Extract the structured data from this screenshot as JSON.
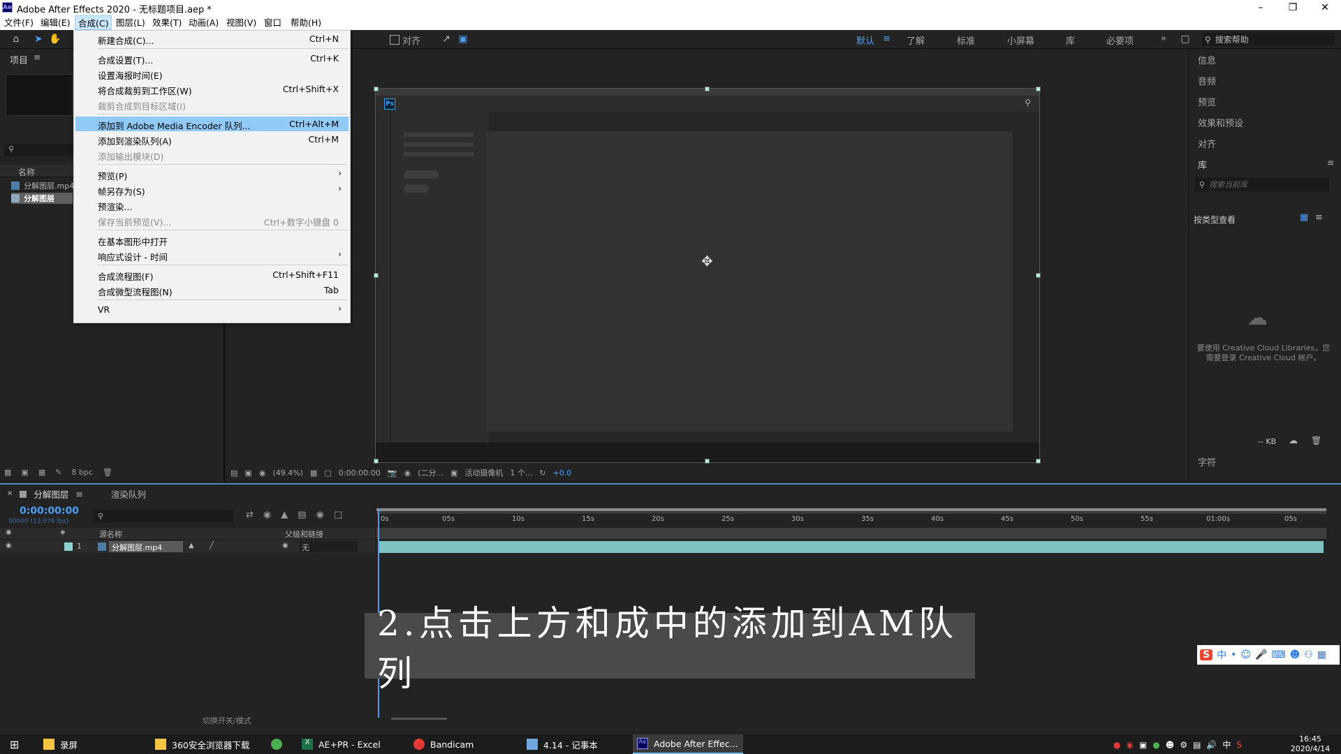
{
  "window": {
    "title": "Adobe After Effects 2020 - 无标题项目.aep *"
  },
  "menubar": [
    "文件(F)",
    "编辑(E)",
    "合成(C)",
    "图层(L)",
    "效果(T)",
    "动画(A)",
    "视图(V)",
    "窗口",
    "帮助(H)"
  ],
  "toolbar": {
    "align_label": "对齐",
    "workspaces": [
      "默认",
      "了解",
      "标准",
      "小屏幕",
      "库",
      "必要项"
    ],
    "search_help": "搜索帮助"
  },
  "project_panel": {
    "title": "项目",
    "col_name": "名称",
    "items": [
      "分解图层.mp4",
      "分解图层"
    ],
    "bpc": "8 bpc"
  },
  "composition_menu": {
    "items": [
      {
        "label": "新建合成(C)...",
        "shortcut": "Ctrl+N"
      },
      {
        "label": "合成设置(T)...",
        "shortcut": "Ctrl+K"
      },
      {
        "label": "设置海报时间(E)",
        "shortcut": ""
      },
      {
        "label": "将合成裁剪到工作区(W)",
        "shortcut": "Ctrl+Shift+X"
      },
      {
        "label": "裁剪合成到目标区域(I)",
        "shortcut": ""
      },
      {
        "label": "添加到 Adobe Media Encoder 队列...",
        "shortcut": "Ctrl+Alt+M"
      },
      {
        "label": "添加到渲染队列(A)",
        "shortcut": "Ctrl+M"
      },
      {
        "label": "添加输出模块(D)",
        "shortcut": ""
      },
      {
        "label": "预览(P)",
        "shortcut": ""
      },
      {
        "label": "帧另存为(S)",
        "shortcut": ""
      },
      {
        "label": "预渲染...",
        "shortcut": ""
      },
      {
        "label": "保存当前预览(V)...",
        "shortcut": "Ctrl+数字小键盘 0"
      },
      {
        "label": "在基本图形中打开",
        "shortcut": ""
      },
      {
        "label": "响应式设计 - 时间",
        "shortcut": ""
      },
      {
        "label": "合成流程图(F)",
        "shortcut": "Ctrl+Shift+F11"
      },
      {
        "label": "合成微型流程图(N)",
        "shortcut": "Tab"
      },
      {
        "label": "VR",
        "shortcut": ""
      }
    ]
  },
  "viewer_bar": {
    "zoom": "(49.4%)",
    "time": "0:00:00:00",
    "resolution": "(二分...",
    "camera": "活动摄像机",
    "views": "1 个...",
    "exposure": "+0.0"
  },
  "right_panel": {
    "items": [
      "信息",
      "音频",
      "预览",
      "效果和预设",
      "对齐",
      "库"
    ],
    "search_placeholder": "搜索当前库",
    "view_by": "按类型查看",
    "cc_message": "要使用 Creative Cloud Libraries，您需要登录 Creative Cloud 帐户。",
    "kb": "-- KB",
    "char": "字符"
  },
  "timeline": {
    "tabs": [
      "分解图层",
      "渲染队列"
    ],
    "timecode": "0:00:00:00",
    "timecode_sub": "00000 (13.978 fps)",
    "col_source": "源名称",
    "col_parent": "父级和链接",
    "layer_num": "1",
    "layer_name": "分解图层.mp4",
    "parent_value": "无",
    "ticks": [
      "0s",
      "05s",
      "10s",
      "15s",
      "20s",
      "25s",
      "30s",
      "35s",
      "40s",
      "45s",
      "50s",
      "55s",
      "01:00s",
      "05s"
    ],
    "footer": "切换开关/模式"
  },
  "subtitle": "2.点击上方和成中的添加到AM队列",
  "taskbar": {
    "tasks": [
      "录屏",
      "360安全浏览器下载",
      "AE+PR - Excel",
      "Bandicam",
      "4.14 - 记事本",
      "Adobe After Effec..."
    ],
    "ime": "中",
    "time": "16:45",
    "date": "2020/4/14"
  }
}
